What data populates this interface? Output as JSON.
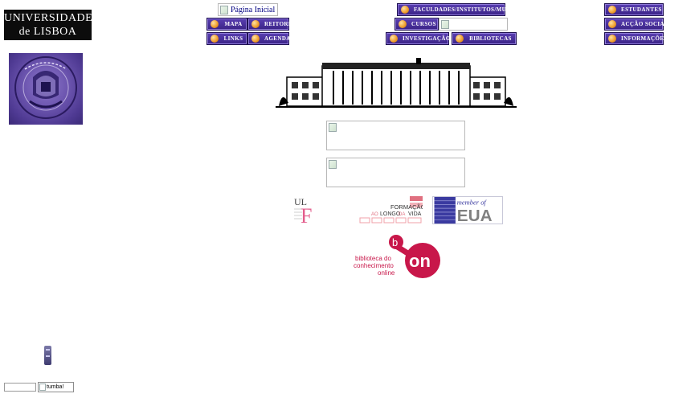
{
  "logo": {
    "line1": "UNIVERSIDADE",
    "line2": "de LISBOA"
  },
  "home_link": "Página Inicial",
  "nav_left": [
    {
      "label": "MAPA"
    },
    {
      "label": "REITORIA"
    },
    {
      "label": "LINKS"
    },
    {
      "label": "AGENDA"
    }
  ],
  "nav_center": [
    {
      "label": "FACULDADES/INSTITUTOS/MUSEUS"
    },
    {
      "label": "CURSOS"
    },
    {
      "label": "INVESTIGAÇÃO"
    },
    {
      "label": "BIBLIOTECAS"
    }
  ],
  "nav_right": [
    {
      "label": "ESTUDANTES"
    },
    {
      "label": "ACÇÃO SOCIAL"
    },
    {
      "label": "INFORMAÇÕES"
    }
  ],
  "logos": {
    "ul": "UL",
    "flv_line1": "FORMAÇÃO",
    "flv_line2a": "AO ",
    "flv_line2b": "LONGO",
    "flv_line2c": " DA ",
    "flv_line2d": "VIDA",
    "eua_top": "member of",
    "eua_main": "EUA",
    "bon_b": "b",
    "bon_on": "on",
    "bon_line1": "biblioteca do",
    "bon_line2": "conhecimento",
    "bon_line3": "online"
  },
  "search": {
    "value": "",
    "button_label": "tumba!"
  },
  "colors": {
    "nav_purple": "#4a2fa0",
    "bon_red": "#c8174a",
    "flv_pink": "#e07080",
    "eua_blue": "#3a3aa0"
  }
}
